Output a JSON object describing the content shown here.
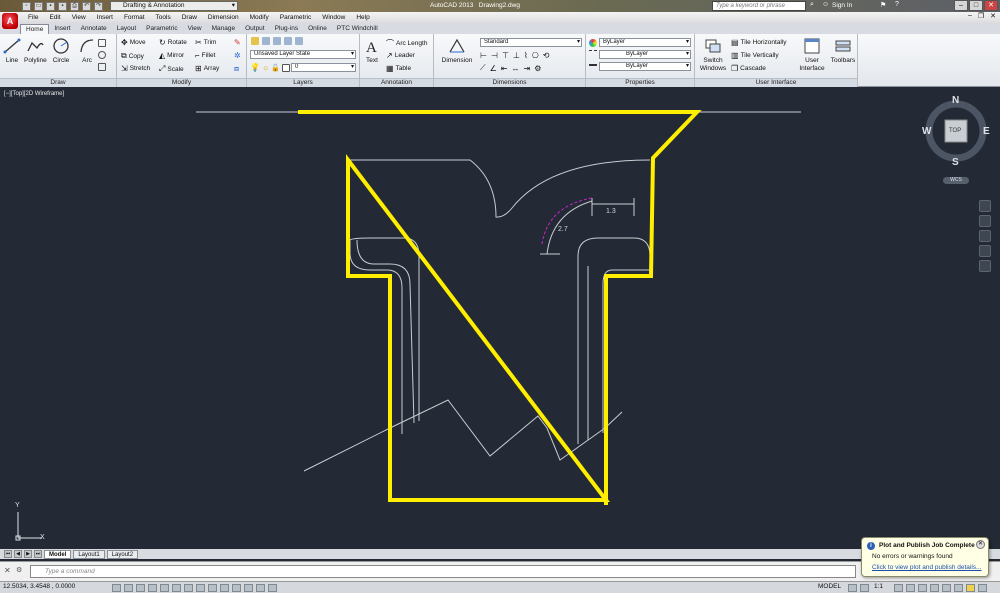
{
  "window": {
    "app_title": "AutoCAD 2013",
    "doc_title": "Drawing2.dwg",
    "workspace": "Drafting & Annotation",
    "search_placeholder": "Type a keyword or phrase",
    "sign_in": "Sign In"
  },
  "menu": [
    "File",
    "Edit",
    "View",
    "Insert",
    "Format",
    "Tools",
    "Draw",
    "Dimension",
    "Modify",
    "Parametric",
    "Window",
    "Help"
  ],
  "tabs": [
    "Home",
    "Insert",
    "Annotate",
    "Layout",
    "Parametric",
    "View",
    "Manage",
    "Output",
    "Plug-ins",
    "Online",
    "PTC Windchill"
  ],
  "ribbon": {
    "draw": {
      "title": "Draw",
      "tools": [
        "Line",
        "Polyline",
        "Circle",
        "Arc"
      ]
    },
    "modify": {
      "title": "Modify",
      "tools": [
        "Move",
        "Rotate",
        "Trim",
        "Copy",
        "Mirror",
        "Fillet",
        "Stretch",
        "Scale",
        "Array"
      ]
    },
    "layers": {
      "title": "Layers",
      "layer_state": "Unsaved Layer State",
      "current_layer": "0"
    },
    "annotation": {
      "title": "Annotation",
      "text": "Text",
      "linear": "Arc Length",
      "leader": "Leader",
      "table": "Table"
    },
    "dimensions": {
      "title": "Dimensions",
      "dimension": "Dimension",
      "style": "Standard"
    },
    "properties": {
      "title": "Properties",
      "color": "ByLayer",
      "linetype": "ByLayer",
      "lineweight": "ByLayer"
    },
    "ui": {
      "title": "User Interface",
      "switch": "Switch Windows",
      "tile_h": "Tile Horizontally",
      "tile_v": "Tile Vertically",
      "cascade": "Cascade",
      "user_interface": "User Interface",
      "toolbars": "Toolbars"
    }
  },
  "viewport": {
    "label": "[−][Top][2D Wireframe]",
    "dim1": "1.3",
    "dim2": "2.7",
    "highlight_color": "#ffee00",
    "line_color": "#c8ccd2"
  },
  "viewcube": {
    "n": "N",
    "s": "S",
    "e": "E",
    "w": "W",
    "face": "TOP",
    "wcs": "WCS"
  },
  "ucs": {
    "x": "X",
    "y": "Y"
  },
  "layouts": [
    "Model",
    "Layout1",
    "Layout2"
  ],
  "command": {
    "placeholder": "Type a command"
  },
  "status": {
    "coords": "12.5034, 3.4548 , 0.0000",
    "space": "MODEL",
    "scale": "1:1"
  },
  "toast": {
    "title": "Plot and Publish Job Complete",
    "message": "No errors or warnings found",
    "link": "Click to view plot and publish details..."
  }
}
